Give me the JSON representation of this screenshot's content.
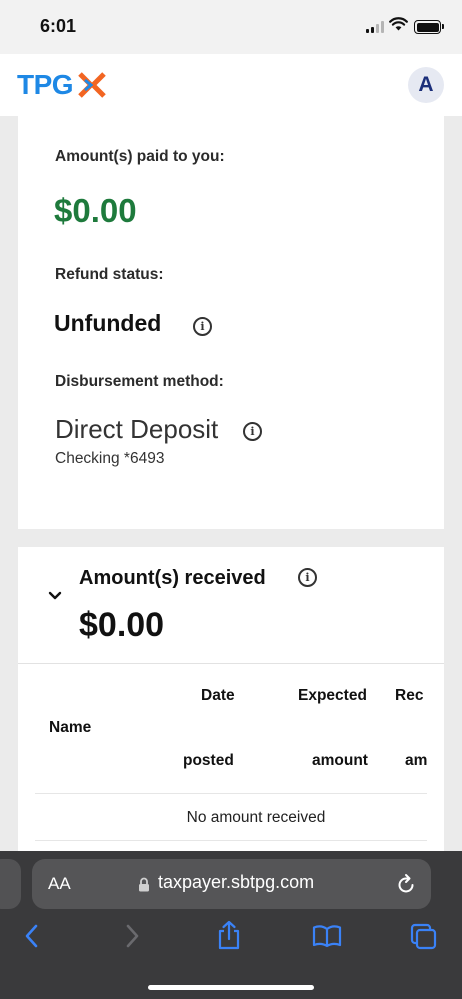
{
  "status_bar": {
    "time": "6:01"
  },
  "header": {
    "logo_text": "TPG",
    "avatar_initial": "A"
  },
  "summary": {
    "paid_label": "Amount(s) paid to you:",
    "paid_value": "$0.00",
    "refund_status_label": "Refund status:",
    "refund_status_value": "Unfunded",
    "method_label": "Disbursement method:",
    "method_value": "Direct Deposit",
    "account": "Checking *6493"
  },
  "received": {
    "title": "Amount(s) received",
    "amount": "$0.00",
    "columns": {
      "name": "Name",
      "date_top": "Date",
      "date_bottom": "posted",
      "expected_top": "Expected",
      "expected_bottom": "amount",
      "received_top": "Rec",
      "received_bottom": "am"
    },
    "empty_message": "No amount received"
  },
  "browser": {
    "text_size_label": "AA",
    "url": "taxpayer.sbtpg.com"
  },
  "colors": {
    "brand_blue": "#1e88e5",
    "brand_orange": "#f26522",
    "paid_green": "#1e7a3c",
    "ios_link_blue": "#3a82f7"
  }
}
